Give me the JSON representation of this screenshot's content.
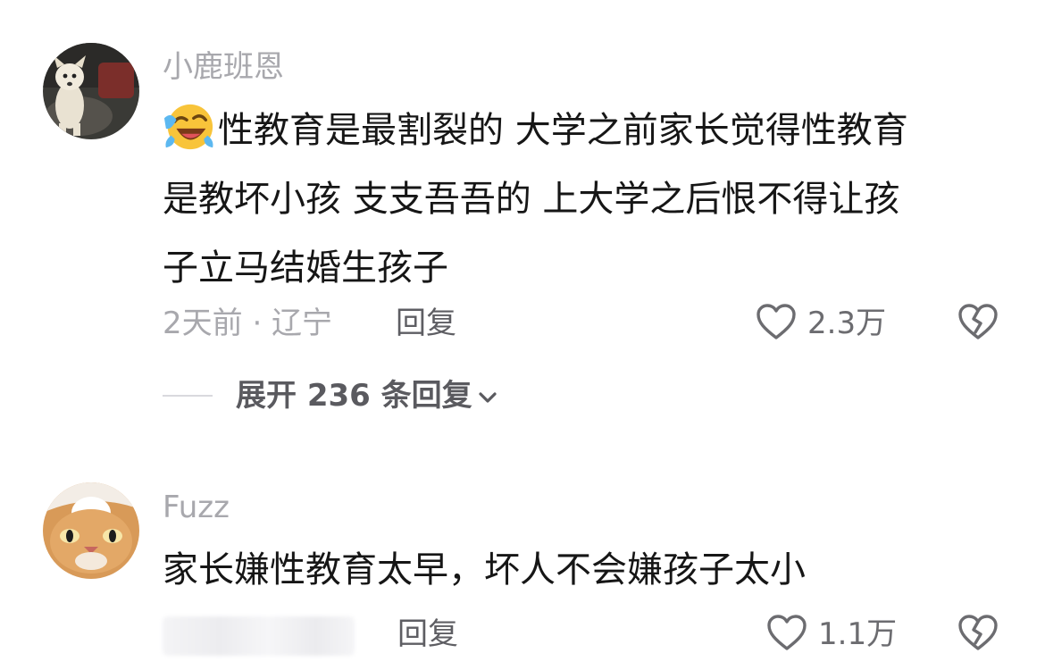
{
  "comments": [
    {
      "username": "小鹿班恩",
      "avatar_icon": "dog-avatar-icon",
      "emoji_icon": "laugh-cry-emoji-icon",
      "lines": [
        "性教育是最割裂的 大学之前家长觉得性教育",
        "是教坏小孩 支支吾吾的 上大学之后恨不得让孩",
        "子立马结婚生孩子"
      ],
      "time_location": "2天前 · 辽宁",
      "reply_label": "回复",
      "like_count": "2.3万",
      "expand_label": "展开 236 条回复"
    },
    {
      "username": "Fuzz",
      "avatar_icon": "cat-avatar-icon",
      "lines": [
        "家长嫌性教育太早，坏人不会嫌孩子太小"
      ],
      "reply_label": "回复",
      "like_count": "1.1万"
    }
  ],
  "colors": {
    "text_primary": "#161616",
    "text_secondary": "#a8a8ad",
    "icon_gray": "#6c6c70",
    "background": "#ffffff"
  }
}
